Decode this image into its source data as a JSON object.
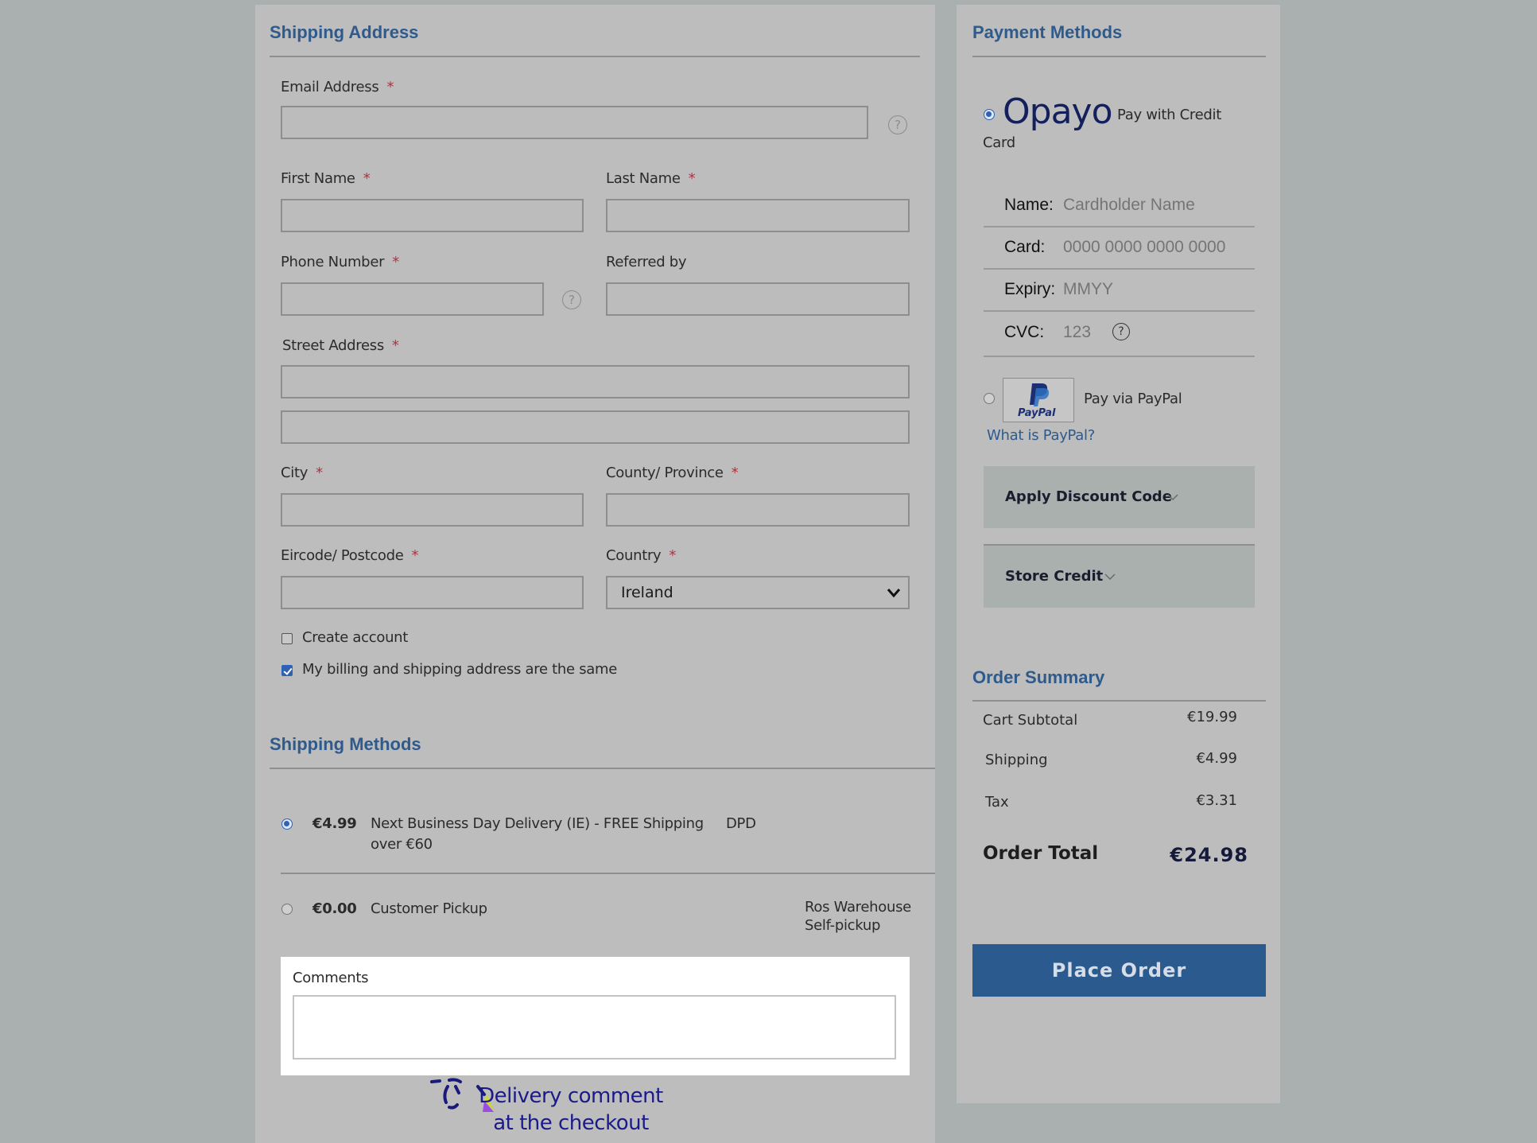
{
  "shipping_address": {
    "title": "Shipping Address",
    "required_mark": "*",
    "fields": {
      "email": {
        "label": "Email Address",
        "value": ""
      },
      "first_name": {
        "label": "First Name",
        "value": ""
      },
      "last_name": {
        "label": "Last Name",
        "value": ""
      },
      "phone": {
        "label": "Phone Number",
        "value": ""
      },
      "referred_by": {
        "label": "Referred by",
        "value": ""
      },
      "street": {
        "label": "Street Address",
        "line1": "",
        "line2": ""
      },
      "city": {
        "label": "City",
        "value": ""
      },
      "county": {
        "label": "County/ Province",
        "value": ""
      },
      "postcode": {
        "label": "Eircode/ Postcode",
        "value": ""
      },
      "country": {
        "label": "Country",
        "selected": "Ireland"
      }
    },
    "help_glyph": "?",
    "checkboxes": [
      {
        "label": "Create account",
        "checked": false
      },
      {
        "label": "My billing and shipping address are the same",
        "checked": true
      }
    ]
  },
  "shipping_methods": {
    "title": "Shipping Methods",
    "options": [
      {
        "price": "€4.99",
        "name_line1": "Next Business Day Delivery (IE) - FREE Shipping",
        "name_line2": "over €60",
        "carrier_line1": "DPD",
        "carrier_line2": "",
        "selected": true
      },
      {
        "price": "€0.00",
        "name_line1": "Customer Pickup",
        "name_line2": "",
        "carrier_line1": "Ros Warehouse",
        "carrier_line2": "Self-pickup",
        "selected": false
      }
    ]
  },
  "comments": {
    "label": "Comments",
    "value": ""
  },
  "annotation": {
    "line1": "Delivery comment",
    "line2": "at the checkout"
  },
  "payment": {
    "title": "Payment Methods",
    "opayo": {
      "logo_text": "Opayo",
      "label_line1": "Pay with Credit",
      "label_line2": "Card",
      "selected": true
    },
    "card_form": {
      "name": {
        "label": "Name:",
        "placeholder": "Cardholder Name"
      },
      "card": {
        "label": "Card:",
        "placeholder": "0000 0000 0000 0000"
      },
      "expiry": {
        "label": "Expiry:",
        "placeholder": "MMYY"
      },
      "cvc": {
        "label": "CVC:",
        "placeholder": "123"
      }
    },
    "paypal": {
      "logo_text": "PayPal",
      "label": "Pay via PayPal",
      "link": "What is PayPal?",
      "selected": false
    },
    "discount": {
      "label": "Apply Discount Code"
    },
    "store_credit": {
      "label": "Store Credit"
    }
  },
  "order_summary": {
    "title": "Order Summary",
    "rows": [
      {
        "label": "Cart Subtotal",
        "value": "€19.99"
      },
      {
        "label": "Shipping",
        "value": "€4.99"
      },
      {
        "label": "Tax",
        "value": "€3.31"
      }
    ],
    "total_label": "Order Total",
    "total_value": "€24.98",
    "place_order": "Place Order"
  },
  "colors": {
    "accent": "#2b5a8e",
    "heading": "#2e5a8c",
    "required": "#b33040",
    "background": "#aab0b0",
    "panel": "#bdbdbd"
  }
}
